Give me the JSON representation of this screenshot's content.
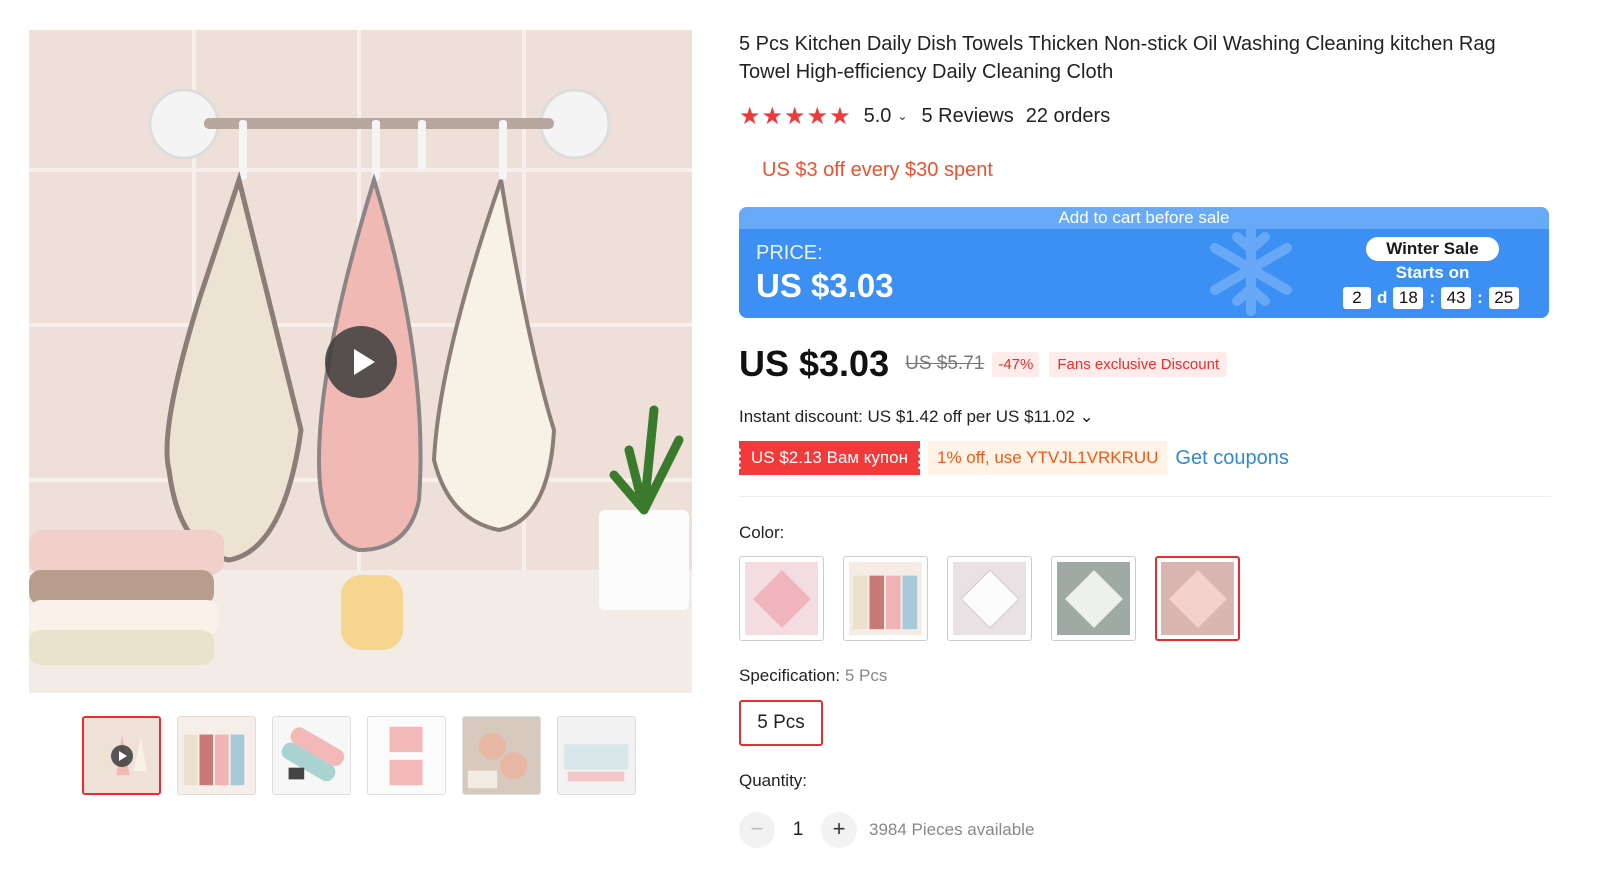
{
  "product": {
    "title": "5 Pcs Kitchen Daily Dish Towels Thicken Non-stick Oil Washing Cleaning kitchen Rag Towel High-efficiency Daily Cleaning Cloth",
    "stars_glyph": "★★★★★",
    "rating": "5.0",
    "rating_chevron": "⌄",
    "reviews": "5 Reviews",
    "orders": "22 orders",
    "store_promo": "US $3 off every $30 spent"
  },
  "sale_banner": {
    "top_text": "Add to cart before sale",
    "price_label": "PRICE:",
    "price": "US $3.03",
    "sale_name": "Winter Sale",
    "starts_on": "Starts on",
    "countdown": {
      "days": "2",
      "day_unit": "d",
      "hours": "18",
      "sep1": ":",
      "minutes": "43",
      "sep2": ":",
      "seconds": "25"
    },
    "icon": "snowflake-icon",
    "color": "#3c90f4"
  },
  "pricing": {
    "current": "US $3.03",
    "original": "US $5.71",
    "discount_pct": "-47%",
    "fans_badge": "Fans exclusive Discount",
    "instant_discount": "Instant discount: US $1.42 off per US $11.02 ⌄"
  },
  "coupons": {
    "red_coupon": "US $2.13 Вам купон",
    "code_coupon": "1% off, use YTVJL1VRKRUU",
    "get_coupons": "Get coupons"
  },
  "color_selector": {
    "label": "Color:",
    "options": [
      "pink-towel",
      "towels-set",
      "white-towel",
      "grey-towel",
      "light-pink-towel"
    ],
    "selected_index": 4
  },
  "specification": {
    "label": "Specification:",
    "selected": "5 Pcs",
    "options": [
      "5 Pcs"
    ]
  },
  "quantity": {
    "label": "Quantity:",
    "minus": "−",
    "value": "1",
    "plus": "+",
    "available": "3984 Pieces available"
  },
  "colors": {
    "accent_red": "#e62e2e",
    "promo_orange": "#f05a14",
    "link_blue": "#2f8ad1",
    "sale_blue": "#3c90f4"
  }
}
